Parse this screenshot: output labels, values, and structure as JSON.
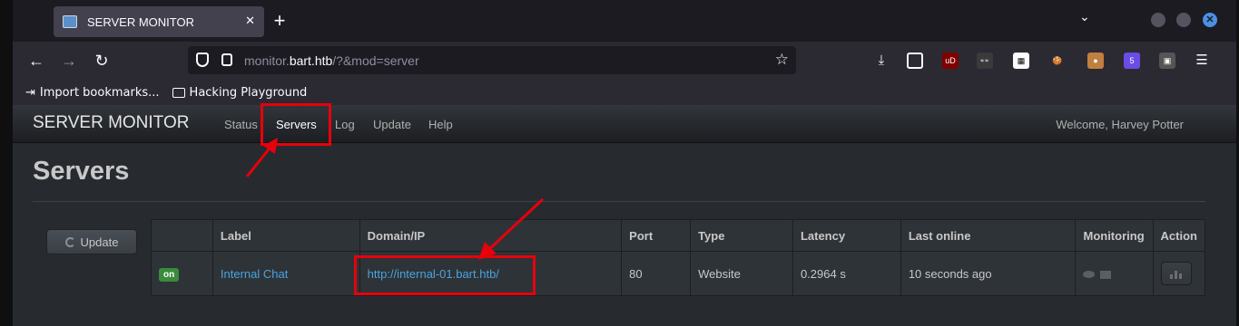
{
  "browser": {
    "tab_title": "SERVER MONITOR",
    "url_prefix": "monitor.",
    "url_domain": "bart.htb",
    "url_path": "/?&mod=server",
    "bookmarks": [
      "Import bookmarks...",
      "Hacking Playground"
    ],
    "ext_badge": "5"
  },
  "app": {
    "brand": "SERVER MONITOR",
    "nav": [
      "Status",
      "Servers",
      "Log",
      "Update",
      "Help"
    ],
    "welcome": "Welcome, Harvey Potter",
    "page_title": "Servers",
    "update_button": "Update"
  },
  "table": {
    "headers": [
      "",
      "Label",
      "Domain/IP",
      "Port",
      "Type",
      "Latency",
      "Last online",
      "Monitoring",
      "Action"
    ],
    "rows": [
      {
        "status": "on",
        "label": "Internal Chat",
        "domain": "http://internal-01.bart.htb/",
        "port": "80",
        "type": "Website",
        "latency": "0.2964 s",
        "last_online": "10 seconds ago"
      }
    ]
  },
  "colors": {
    "annotation": "#e8000b",
    "link": "#4aa3df",
    "status_on": "#3a8c3a"
  }
}
